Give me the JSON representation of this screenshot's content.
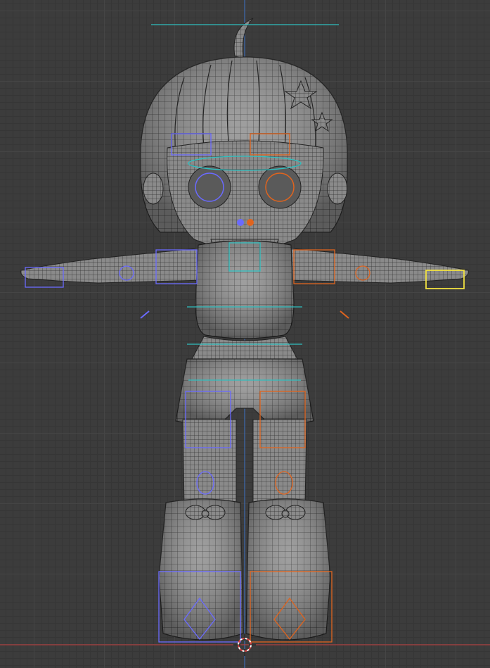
{
  "viewport": {
    "background": "#3c3c3c",
    "grid_color": "#454545",
    "x_axis_color": "#c43a3a",
    "z_axis_color": "#3a6fc4"
  },
  "model": {
    "mesh_fill": "#8c8c8c",
    "wire_color": "#2a2a2a",
    "left_bone_color": "#6a6aff",
    "right_bone_color": "#e0641e",
    "center_bone_color": "#2fc0c0",
    "selected_bone_color": "#f0e040"
  },
  "gizmos": {
    "cursor_icon": "3d-cursor-icon"
  }
}
